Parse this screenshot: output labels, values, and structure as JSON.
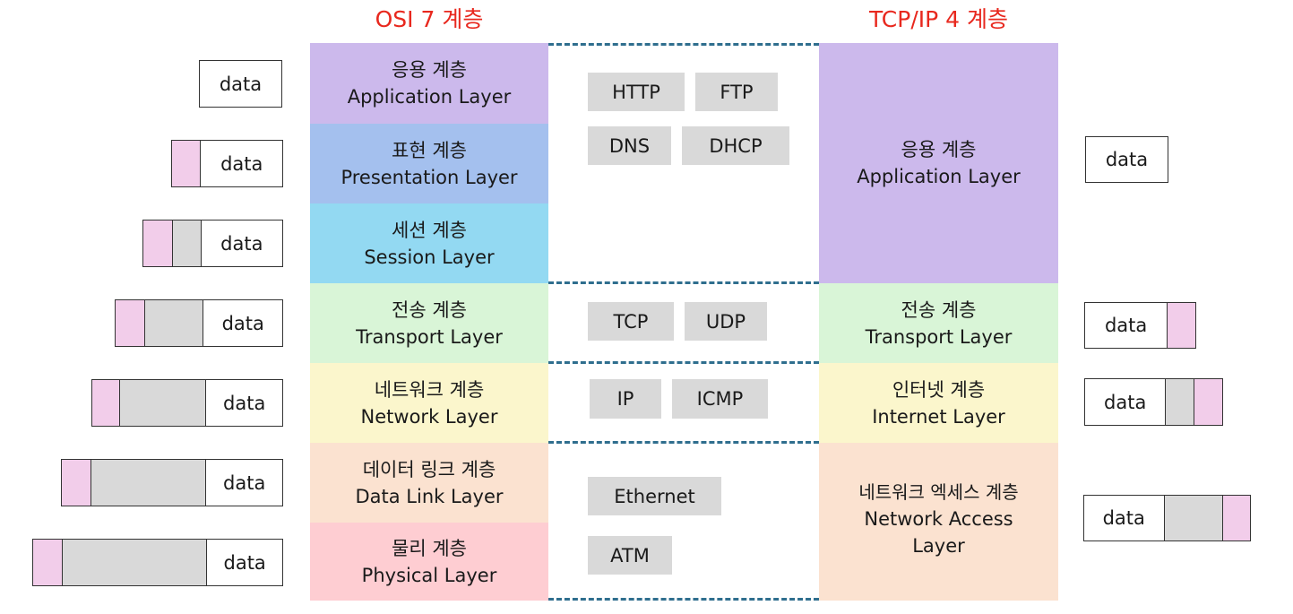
{
  "titles": {
    "osi": "OSI 7 계층",
    "tcpip": "TCP/IP 4 계층"
  },
  "osi_layers": [
    {
      "ko": "응용 계층",
      "en": "Application Layer",
      "color": "#ccb9ec"
    },
    {
      "ko": "표현 계층",
      "en": "Presentation Layer",
      "color": "#a4c0ee"
    },
    {
      "ko": "세션 계층",
      "en": "Session Layer",
      "color": "#93d9f2"
    },
    {
      "ko": "전송 계층",
      "en": "Transport Layer",
      "color": "#d9f5d7"
    },
    {
      "ko": "네트워크 계층",
      "en": "Network Layer",
      "color": "#fbf6cc"
    },
    {
      "ko": "데이터 링크 계층",
      "en": "Data Link Layer",
      "color": "#fbe2d0"
    },
    {
      "ko": "물리 계층",
      "en": "Physical Layer",
      "color": "#fecdd2"
    }
  ],
  "tcpip_layers": [
    {
      "ko": "응용 계층",
      "en": "Application Layer",
      "color": "#ccb9ec"
    },
    {
      "ko": "전송 계층",
      "en": "Transport Layer",
      "color": "#d9f5d7"
    },
    {
      "ko": "인터넷 계층",
      "en": "Internet Layer",
      "color": "#fbf6cc"
    },
    {
      "ko": "네트워크 엑세스 계층",
      "en": "Network Access",
      "en2": "Layer",
      "color": "#fbe2d0"
    }
  ],
  "protocols": [
    "HTTP",
    "FTP",
    "DNS",
    "DHCP",
    "TCP",
    "UDP",
    "IP",
    "ICMP",
    "Ethernet",
    "ATM"
  ],
  "data_label": "data",
  "colors": {
    "title": "#e8281e",
    "header_pink": "#f2cdea",
    "header_gray": "#d9d9d9",
    "protocol_box": "#d9d9d9",
    "divider": "#2f6e8e"
  }
}
